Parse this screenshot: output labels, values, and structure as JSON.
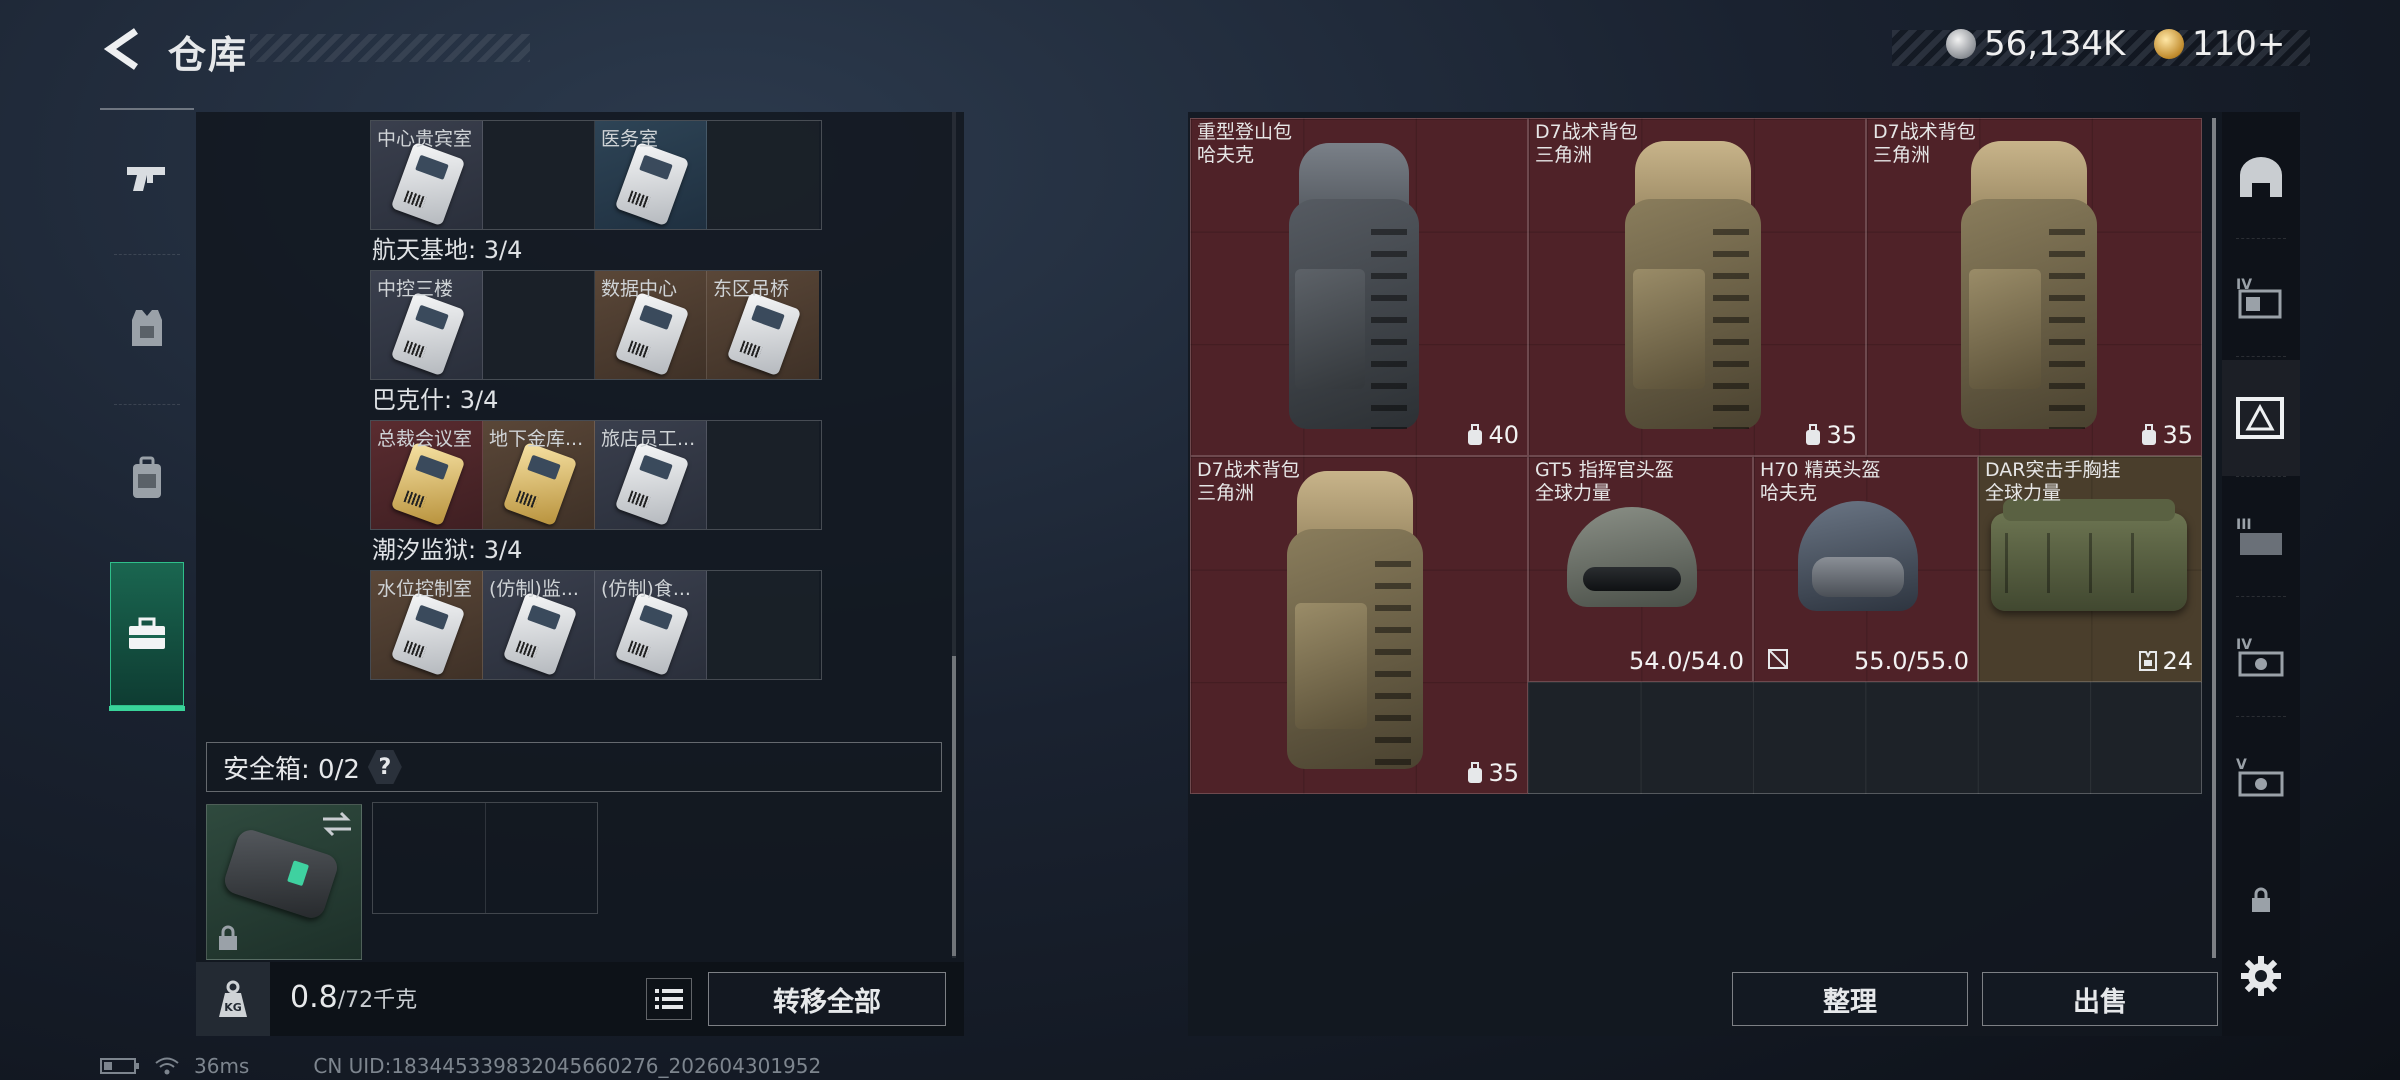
{
  "header": {
    "title": "仓库",
    "currency": [
      {
        "icon": "silver-coin-icon",
        "value": "56,134K"
      },
      {
        "icon": "gold-coin-icon",
        "value": "110+"
      }
    ]
  },
  "category_tabs": [
    {
      "icon": "gun-icon",
      "active": false
    },
    {
      "icon": "armor-vest-icon",
      "active": false
    },
    {
      "icon": "backpack-icon",
      "active": false
    },
    {
      "icon": "toolbox-icon",
      "active": true
    }
  ],
  "key_maps": [
    {
      "title": "",
      "cells": [
        {
          "label": "中心贵宾室",
          "tone": "grey",
          "card": "silver"
        },
        {
          "label": "",
          "tone": "empty"
        },
        {
          "label": "医务室",
          "tone": "blue",
          "card": "silver"
        },
        {
          "label": "",
          "tone": "empty"
        }
      ]
    },
    {
      "title": "航天基地: 3/4",
      "cells": [
        {
          "label": "中控三楼",
          "tone": "grey",
          "card": "silver"
        },
        {
          "label": "",
          "tone": "empty"
        },
        {
          "label": "数据中心",
          "tone": "brown",
          "card": "silver"
        },
        {
          "label": "东区吊桥",
          "tone": "brown",
          "card": "silver"
        }
      ]
    },
    {
      "title": "巴克什: 3/4",
      "cells": [
        {
          "label": "总裁会议室",
          "tone": "red",
          "card": "gold"
        },
        {
          "label": "地下金库...",
          "tone": "brown",
          "card": "gold"
        },
        {
          "label": "旅店员工...",
          "tone": "grey",
          "card": "silver"
        },
        {
          "label": "",
          "tone": "empty"
        }
      ]
    },
    {
      "title": "潮汐监狱: 3/4",
      "cells": [
        {
          "label": "水位控制室",
          "tone": "brown",
          "card": "silver"
        },
        {
          "label": "(仿制)监...",
          "tone": "grey",
          "card": "silver"
        },
        {
          "label": "(仿制)食...",
          "tone": "grey",
          "card": "silver"
        },
        {
          "label": "",
          "tone": "empty"
        }
      ]
    }
  ],
  "safebox": {
    "label": "安全箱: 0/2",
    "help": "?"
  },
  "footer": {
    "weight_current": "0.8",
    "weight_max": "/72千克",
    "transfer_all": "转移全部"
  },
  "warehouse_items": [
    {
      "name": "重型登山包",
      "brand": "哈夫克",
      "stat": "40",
      "stat_icon": "backpack-capacity-icon"
    },
    {
      "name": "D7战术背包",
      "brand": "三角洲",
      "stat": "35",
      "stat_icon": "backpack-capacity-icon"
    },
    {
      "name": "D7战术背包",
      "brand": "三角洲",
      "stat": "35",
      "stat_icon": "backpack-capacity-icon"
    },
    {
      "name": "D7战术背包",
      "brand": "三角洲",
      "stat": "35",
      "stat_icon": "backpack-capacity-icon"
    },
    {
      "name": "GT5 指挥官头盔",
      "brand": "全球力量",
      "stat": "54.0/54.0"
    },
    {
      "name": "H70 精英头盔",
      "brand": "哈夫克",
      "stat": "55.0/55.0"
    },
    {
      "name": "DAR突击手胸挂",
      "brand": "全球力量",
      "stat": "24",
      "stat_icon": "chest-rig-capacity-icon"
    }
  ],
  "actions": {
    "sort": "整理",
    "sell": "出售"
  },
  "side_rail": [
    {
      "icon": "helmet-slot-icon"
    },
    {
      "icon": "storage-iv-icon"
    },
    {
      "icon": "storage-expand-icon",
      "active": true
    },
    {
      "icon": "storage-iii-icon"
    },
    {
      "icon": "storage-iv-alt-icon"
    },
    {
      "icon": "storage-v-icon"
    },
    {
      "icon": "lock-icon"
    },
    {
      "icon": "settings-gear-icon"
    }
  ],
  "status": {
    "ping": "36ms",
    "uid": "CN UID:1834453398320456602​76_202604301952"
  }
}
